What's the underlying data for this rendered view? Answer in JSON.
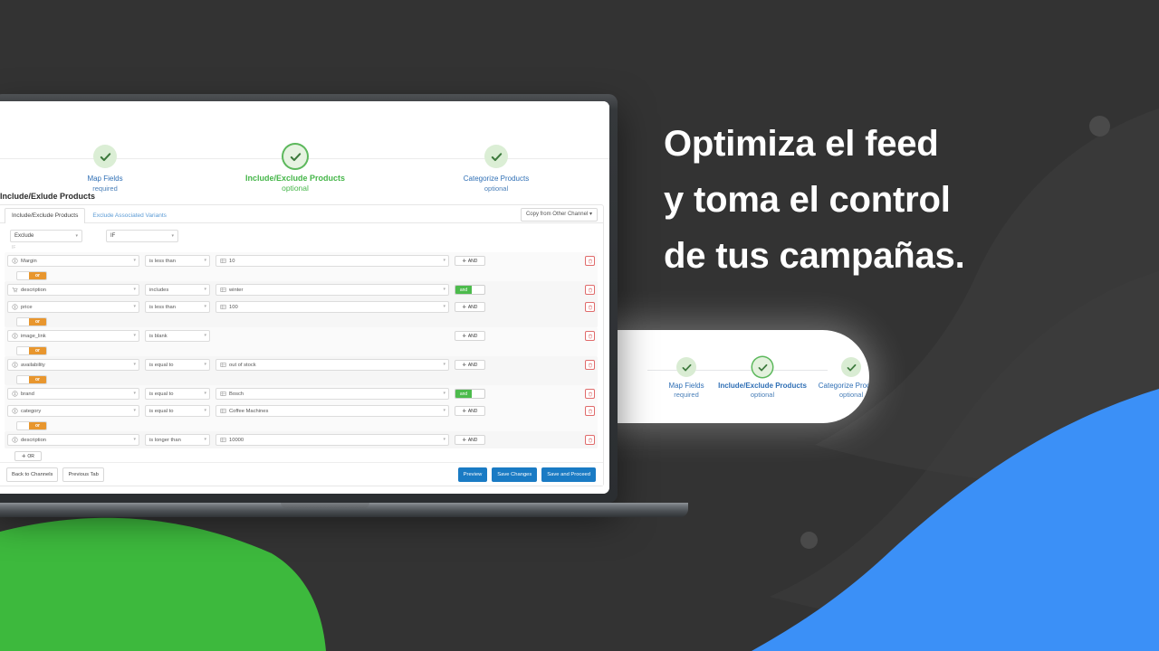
{
  "headline": {
    "line1": "Optimiza el feed",
    "line2": "y toma el control",
    "line3": "de tus campañas."
  },
  "colors": {
    "background": "#333333",
    "green_blob": "#3DB93D",
    "blue_blob": "#3B90F7",
    "accent_green": "#45B649",
    "accent_blue": "#1A7BC4",
    "accent_orange": "#E8962E",
    "danger_red": "#E06B6B"
  },
  "app": {
    "page_title": "Include/Exlude Products",
    "steps": [
      {
        "label": "Map Fields",
        "sub": "required",
        "state": "done",
        "icon": "check-icon"
      },
      {
        "label": "Include/Exclude Products",
        "sub": "optional",
        "state": "active",
        "icon": "check-icon"
      },
      {
        "label": "Categorize Products",
        "sub": "optional",
        "state": "done",
        "icon": "check-icon"
      }
    ],
    "tabs": [
      {
        "label": "Include/Exclude Products",
        "active": true
      },
      {
        "label": "Exclude Associated Variants",
        "active": false
      }
    ],
    "copy_button": "Copy from Other Channel",
    "copy_button_caret": "▾",
    "top_selects": [
      {
        "name": "action-select",
        "value": "Exclude"
      },
      {
        "name": "condition-select",
        "value": "IF"
      }
    ],
    "if_note": "IF",
    "and_label": "AND",
    "and_on_label": "and",
    "or_label": "or",
    "add_or_label": "OR",
    "plus_glyph": "✛",
    "caret_glyph": "▾",
    "groups": [
      {
        "rules": [
          {
            "field": "Margin",
            "field_icon": "currency-icon",
            "operator": "is less than",
            "value": "10",
            "value_icon": "grid-icon",
            "connector": "and-button"
          }
        ]
      },
      {
        "rules": [
          {
            "field": "description",
            "field_icon": "cart-icon",
            "operator": "includes",
            "value": "winter",
            "value_icon": "grid-icon",
            "connector": "and-toggle"
          },
          {
            "field": "price",
            "field_icon": "currency-icon",
            "operator": "is less than",
            "value": "100",
            "value_icon": "grid-icon",
            "connector": "and-button"
          }
        ]
      },
      {
        "rules": [
          {
            "field": "image_link",
            "field_icon": "currency-icon",
            "operator": "is blank",
            "value": "",
            "value_icon": "",
            "connector": "and-button"
          }
        ]
      },
      {
        "rules": [
          {
            "field": "availability",
            "field_icon": "currency-icon",
            "operator": "is equal to",
            "value": "out of stock",
            "value_icon": "grid-icon",
            "connector": "and-button"
          }
        ]
      },
      {
        "rules": [
          {
            "field": "brand",
            "field_icon": "currency-icon",
            "operator": "is equal to",
            "value": "Bosch",
            "value_icon": "grid-icon",
            "connector": "and-toggle"
          },
          {
            "field": "category",
            "field_icon": "currency-icon",
            "operator": "is equal to",
            "value": "Coffee Machines",
            "value_icon": "grid-icon",
            "connector": "and-button"
          }
        ]
      },
      {
        "rules": [
          {
            "field": "description",
            "field_icon": "currency-icon",
            "operator": "is longer than",
            "value": "10000",
            "value_icon": "grid-icon",
            "connector": "and-button"
          }
        ]
      }
    ],
    "footer": {
      "back": "Back to Channels",
      "previous": "Previous Tab",
      "preview": "Preview",
      "save": "Save Changes",
      "save_proceed": "Save and Proceed"
    }
  },
  "mini_panel": {
    "steps": [
      {
        "label": "Map Fields",
        "sub": "required",
        "state": "done"
      },
      {
        "label": "Include/Exclude Products",
        "sub": "optional",
        "state": "active"
      },
      {
        "label": "Categorize Products",
        "sub": "optional",
        "state": "done"
      }
    ]
  }
}
